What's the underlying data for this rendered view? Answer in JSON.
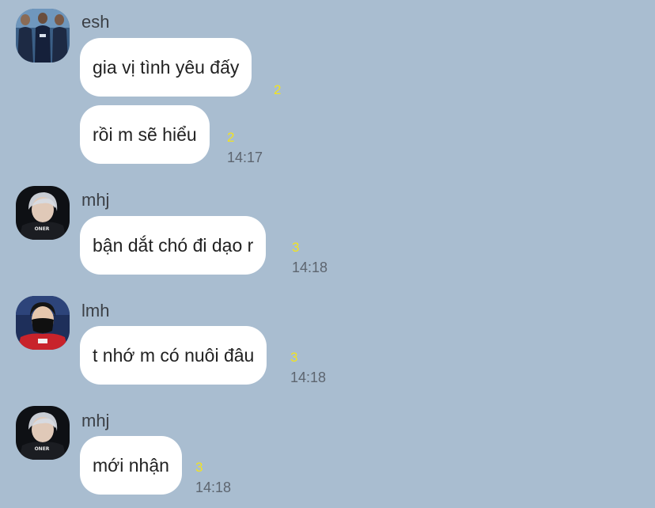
{
  "messages": [
    {
      "sender": "esh",
      "avatar": "team-photo-avatar",
      "bubbles": [
        {
          "text": "gia vị tình yêu đấy",
          "unread": "2",
          "time": ""
        },
        {
          "text": "rồi m sẽ hiểu",
          "unread": "2",
          "time": "14:17"
        }
      ]
    },
    {
      "sender": "mhj",
      "avatar": "player-oner-avatar",
      "avatar_text": "ONER",
      "bubbles": [
        {
          "text": "bận dắt chó đi dạo r",
          "unread": "3",
          "time": "14:18"
        }
      ]
    },
    {
      "sender": "lmh",
      "avatar": "masked-player-avatar",
      "bubbles": [
        {
          "text": "t nhớ m có nuôi đâu",
          "unread": "3",
          "time": "14:18"
        }
      ]
    },
    {
      "sender": "mhj",
      "avatar": "player-oner-avatar",
      "avatar_text": "ONER",
      "bubbles": [
        {
          "text": "mới nhận",
          "unread": "3",
          "time": "14:18"
        }
      ]
    }
  ],
  "colors": {
    "background": "#a9bdd0",
    "bubble": "#ffffff",
    "unread": "#f2e31f",
    "time": "#5d656f"
  }
}
